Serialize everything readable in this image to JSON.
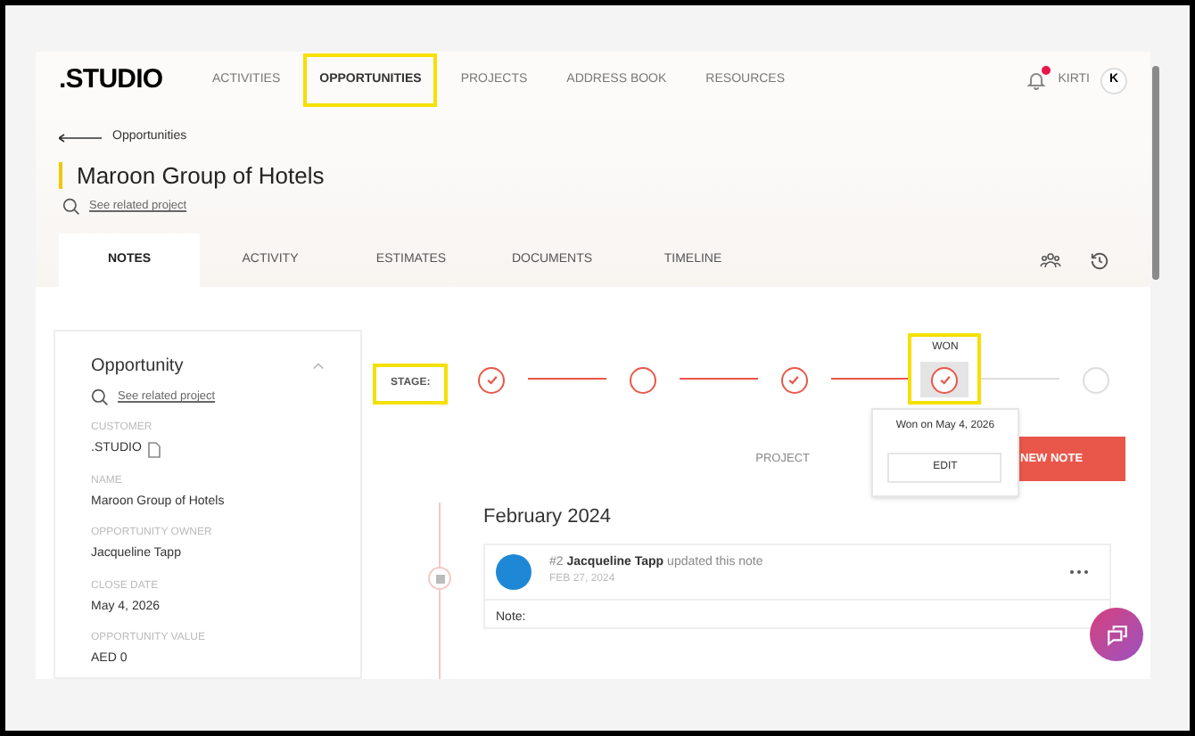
{
  "header": {
    "logo": ".STUDIO",
    "nav": [
      {
        "label": "ACTIVITIES",
        "selected": false,
        "highlighted": false
      },
      {
        "label": "OPPORTUNITIES",
        "selected": true,
        "highlighted": true
      },
      {
        "label": "PROJECTS",
        "selected": false,
        "highlighted": false
      },
      {
        "label": "ADDRESS BOOK",
        "selected": false,
        "highlighted": false
      },
      {
        "label": "RESOURCES",
        "selected": false,
        "highlighted": false
      }
    ],
    "notification_unread": true,
    "user_name": "KIRTI",
    "avatar_initial": "K"
  },
  "breadcrumb": "Opportunities",
  "title": "Maroon Group of Hotels",
  "related_link": "See related project",
  "tabs": [
    {
      "label": "NOTES",
      "selected": true
    },
    {
      "label": "ACTIVITY",
      "selected": false
    },
    {
      "label": "ESTIMATES",
      "selected": false
    },
    {
      "label": "DOCUMENTS",
      "selected": false
    },
    {
      "label": "TIMELINE",
      "selected": false
    }
  ],
  "opportunity_card": {
    "title": "Opportunity",
    "expanded": true,
    "related_link": "See related project",
    "fields": [
      {
        "label": "CUSTOMER",
        "value": ".STUDIO",
        "copy_icon": true
      },
      {
        "label": "NAME",
        "value": "Maroon Group of Hotels",
        "copy_icon": false
      },
      {
        "label": "OPPORTUNITY OWNER",
        "value": "Jacqueline Tapp",
        "copy_icon": false
      },
      {
        "label": "CLOSE DATE",
        "value": "May 4, 2026",
        "copy_icon": false
      },
      {
        "label": "OPPORTUNITY VALUE",
        "value": "AED 0",
        "copy_icon": false
      }
    ]
  },
  "stage": {
    "label": "STAGE:",
    "highlighted": true,
    "steps": [
      {
        "reached": true,
        "checked": true,
        "selected": false
      },
      {
        "reached": true,
        "checked": false,
        "selected": false
      },
      {
        "reached": true,
        "checked": true,
        "selected": false
      },
      {
        "reached": true,
        "checked": true,
        "selected": true,
        "label": "WON",
        "highlighted": true
      },
      {
        "reached": false,
        "checked": false,
        "selected": false
      }
    ],
    "popover": {
      "text": "Won on May 4, 2026",
      "button": "EDIT"
    }
  },
  "actions": {
    "project_label": "PROJECT",
    "new_note": "NEW NOTE"
  },
  "timeline": {
    "month": "February 2024",
    "notes": [
      {
        "number": "#2",
        "author": "Jacqueline Tapp",
        "action": "updated this note",
        "date": "FEB 27, 2024",
        "body_label": "Note:"
      }
    ]
  }
}
